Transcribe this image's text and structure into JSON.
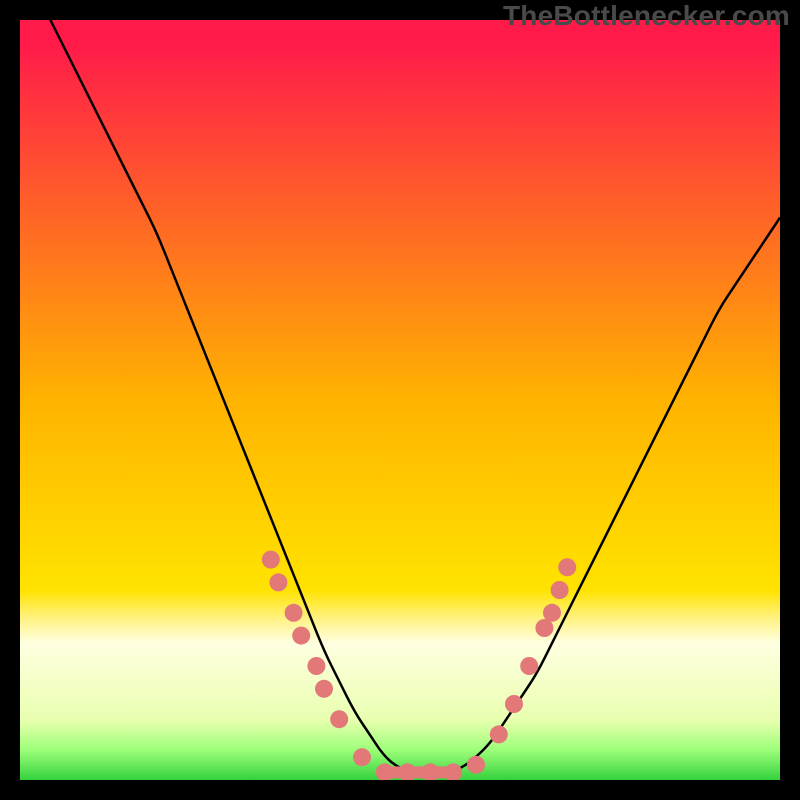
{
  "watermark": "TheBottlenecker.com",
  "colors": {
    "top": "#ff1a4a",
    "mid": "#ffd400",
    "green": "#34d23d",
    "markers": "#e27878",
    "curve": "#000000"
  },
  "chart_data": {
    "type": "line",
    "title": "",
    "xlabel": "",
    "ylabel": "",
    "xlim": [
      0,
      100
    ],
    "ylim": [
      0,
      100
    ],
    "background_gradient": {
      "stops": [
        {
          "pos": 0.0,
          "color": "#ff1a4a"
        },
        {
          "pos": 0.03,
          "color": "#ff1a4a"
        },
        {
          "pos": 0.5,
          "color": "#ffb300"
        },
        {
          "pos": 0.75,
          "color": "#ffe300"
        },
        {
          "pos": 0.79,
          "color": "#fff38a"
        },
        {
          "pos": 0.82,
          "color": "#ffffe0"
        },
        {
          "pos": 0.92,
          "color": "#e9ffb0"
        },
        {
          "pos": 0.96,
          "color": "#9eff7a"
        },
        {
          "pos": 1.0,
          "color": "#34d23d"
        }
      ]
    },
    "series": [
      {
        "name": "bottleneck-curve",
        "x": [
          4,
          6,
          8,
          10,
          12,
          14,
          16,
          18,
          20,
          22,
          24,
          26,
          28,
          30,
          32,
          34,
          36,
          38,
          40,
          42,
          44,
          46,
          48,
          50,
          52,
          54,
          56,
          58,
          60,
          62,
          64,
          66,
          68,
          70,
          72,
          74,
          76,
          78,
          80,
          82,
          84,
          86,
          88,
          90,
          92,
          94,
          96,
          98,
          100
        ],
        "y": [
          100,
          96,
          92,
          88,
          84,
          80,
          76,
          72,
          67,
          62,
          57,
          52,
          47,
          42,
          37,
          32,
          27,
          22,
          17,
          13,
          9,
          6,
          3,
          1.5,
          1,
          1,
          1,
          1.5,
          3,
          5,
          8,
          11,
          14,
          18,
          22,
          26,
          30,
          34,
          38,
          42,
          46,
          50,
          54,
          58,
          62,
          65,
          68,
          71,
          74
        ]
      }
    ],
    "markers": [
      {
        "x": 33,
        "y": 29
      },
      {
        "x": 34,
        "y": 26
      },
      {
        "x": 36,
        "y": 22
      },
      {
        "x": 37,
        "y": 19
      },
      {
        "x": 39,
        "y": 15
      },
      {
        "x": 40,
        "y": 12
      },
      {
        "x": 42,
        "y": 8
      },
      {
        "x": 45,
        "y": 3
      },
      {
        "x": 48,
        "y": 1
      },
      {
        "x": 51,
        "y": 1
      },
      {
        "x": 54,
        "y": 1
      },
      {
        "x": 57,
        "y": 1
      },
      {
        "x": 60,
        "y": 2
      },
      {
        "x": 63,
        "y": 6
      },
      {
        "x": 65,
        "y": 10
      },
      {
        "x": 67,
        "y": 15
      },
      {
        "x": 69,
        "y": 20
      },
      {
        "x": 70,
        "y": 22
      },
      {
        "x": 71,
        "y": 25
      },
      {
        "x": 72,
        "y": 28
      }
    ]
  }
}
